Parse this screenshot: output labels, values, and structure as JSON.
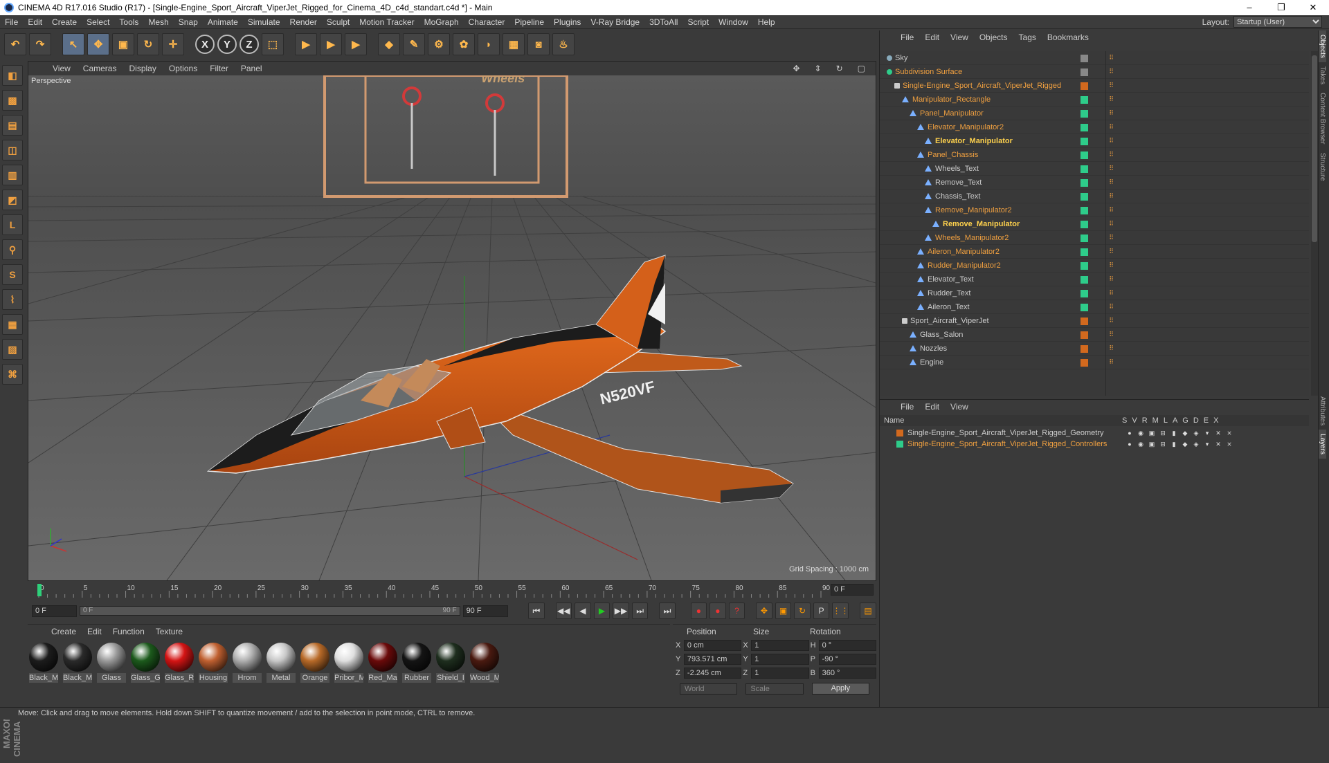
{
  "window": {
    "title": "CINEMA 4D R17.016 Studio (R17) - [Single-Engine_Sport_Aircraft_ViperJet_Rigged_for_Cinema_4D_c4d_standart.c4d *] - Main",
    "min": "–",
    "max": "❐",
    "close": "✕"
  },
  "menu": [
    "File",
    "Edit",
    "Create",
    "Select",
    "Tools",
    "Mesh",
    "Snap",
    "Animate",
    "Simulate",
    "Render",
    "Sculpt",
    "Motion Tracker",
    "MoGraph",
    "Character",
    "Pipeline",
    "Plugins",
    "V-Ray Bridge",
    "3DToAll",
    "Script",
    "Window",
    "Help"
  ],
  "layout": {
    "label": "Layout:",
    "value": "Startup (User)"
  },
  "toolbar": {
    "undo": "↶",
    "redo": "↷",
    "select": "↖",
    "move": "✥",
    "scale": "▣",
    "rotate": "↻",
    "move2": "✛",
    "x": "X",
    "y": "Y",
    "z": "Z",
    "coord": "⬚",
    "render1": "▶",
    "render2": "▶",
    "render3": "▶",
    "cube": "◆",
    "pen": "✎",
    "gear": "⚙",
    "flower": "✿",
    "deform": "◗",
    "grid": "▦",
    "camera": "◙",
    "light": "♨"
  },
  "lefttools": [
    "◧",
    "▩",
    "▤",
    "◫",
    "▥",
    "◩",
    "L",
    "⚲",
    "S",
    "⌇",
    "▦",
    "▨",
    "⌘"
  ],
  "maxon": "MAXON CINEMA 4D",
  "viewport": {
    "menu": [
      "View",
      "Cameras",
      "Display",
      "Options",
      "Filter",
      "Panel"
    ],
    "icons": [
      "✥",
      "⇕",
      "↻",
      "▢"
    ],
    "label": "Perspective",
    "grid_spacing": "Grid Spacing : 1000 cm",
    "tail_number": "N520VF",
    "ghost_text": "Wheels"
  },
  "timeline": {
    "ticks": [
      "0",
      "5",
      "10",
      "15",
      "20",
      "25",
      "30",
      "35",
      "40",
      "45",
      "50",
      "55",
      "60",
      "65",
      "70",
      "75",
      "80",
      "85",
      "90"
    ],
    "current_frame": "0 F"
  },
  "transport": {
    "start": "0 F",
    "slider_start": "0 F",
    "slider_end": "90 F",
    "end": "90 F",
    "btns": [
      "⏮",
      "◀◀",
      "◀",
      "▶",
      "▶▶",
      "⏭",
      "⏭"
    ],
    "rec": [
      "●",
      "●",
      "?"
    ],
    "keys": [
      "✥",
      "▣",
      "↻",
      "P",
      "⋮⋮",
      "▤"
    ]
  },
  "materials": {
    "menu": [
      "Create",
      "Edit",
      "Function",
      "Texture"
    ],
    "items": [
      {
        "label": "Black_M",
        "color": "#1c1c1c"
      },
      {
        "label": "Black_M",
        "color": "#2a2a2a"
      },
      {
        "label": "Glass",
        "color": "#9a9a9a"
      },
      {
        "label": "Glass_G",
        "color": "#1c5a1c"
      },
      {
        "label": "Glass_R",
        "color": "#d41414"
      },
      {
        "label": "Housing",
        "color": "#c06030"
      },
      {
        "label": "Hrom",
        "color": "#b0b0b0"
      },
      {
        "label": "Metal",
        "color": "#c8c8c8"
      },
      {
        "label": "Orange",
        "color": "#b86a28"
      },
      {
        "label": "Pribor_M",
        "color": "#e0e0e0"
      },
      {
        "label": "Red_Ma",
        "color": "#6a0a0a"
      },
      {
        "label": "Rubber",
        "color": "#141414"
      },
      {
        "label": "Shield_I",
        "color": "#1e2e1e"
      },
      {
        "label": "Wood_M",
        "color": "#4a1a10"
      }
    ]
  },
  "coords": {
    "head": {
      "position": "Position",
      "size": "Size",
      "rotation": "Rotation"
    },
    "rows": [
      {
        "ax": "X",
        "pos": "0 cm",
        "sax": "X",
        "size": "1",
        "rax": "H",
        "rot": "0 °"
      },
      {
        "ax": "Y",
        "pos": "793.571 cm",
        "sax": "Y",
        "size": "1",
        "rax": "P",
        "rot": "-90 °"
      },
      {
        "ax": "Z",
        "pos": "-2.245 cm",
        "sax": "Z",
        "size": "1",
        "rax": "B",
        "rot": "360 °"
      }
    ],
    "world": "World",
    "scale": "Scale",
    "apply": "Apply"
  },
  "status": "Move: Click and drag to move elements. Hold down SHIFT to quantize movement / add to the selection in point mode, CTRL to remove.",
  "objects": {
    "menu": [
      "File",
      "Edit",
      "View",
      "Objects",
      "Tags",
      "Bookmarks"
    ],
    "rows": [
      {
        "name": "Sky",
        "indent": 0,
        "kind": "sky",
        "swatch": "#888",
        "color": "plain"
      },
      {
        "name": "Subdivision Surface",
        "indent": 0,
        "kind": "gear",
        "swatch": "#888",
        "color": "orange"
      },
      {
        "name": "Single-Engine_Sport_Aircraft_ViperJet_Rigged",
        "indent": 1,
        "kind": "null",
        "swatch": "#d2691e",
        "color": "orange"
      },
      {
        "name": "Manipulator_Rectangle",
        "indent": 2,
        "kind": "tri",
        "swatch": "#2ecc8a",
        "color": "orange"
      },
      {
        "name": "Panel_Manipulator",
        "indent": 3,
        "kind": "tri",
        "swatch": "#2ecc8a",
        "color": "orange"
      },
      {
        "name": "Elevator_Manipulator2",
        "indent": 4,
        "kind": "tri",
        "swatch": "#2ecc8a",
        "color": "orange"
      },
      {
        "name": "Elevator_Manipulator",
        "indent": 5,
        "kind": "tri",
        "swatch": "#2ecc8a",
        "color": "yellow"
      },
      {
        "name": "Panel_Chassis",
        "indent": 4,
        "kind": "tri",
        "swatch": "#2ecc8a",
        "color": "orange"
      },
      {
        "name": "Wheels_Text",
        "indent": 5,
        "kind": "tri",
        "swatch": "#2ecc8a",
        "color": "plain"
      },
      {
        "name": "Remove_Text",
        "indent": 5,
        "kind": "tri",
        "swatch": "#2ecc8a",
        "color": "plain"
      },
      {
        "name": "Chassis_Text",
        "indent": 5,
        "kind": "tri",
        "swatch": "#2ecc8a",
        "color": "plain"
      },
      {
        "name": "Remove_Manipulator2",
        "indent": 5,
        "kind": "tri",
        "swatch": "#2ecc8a",
        "color": "orange"
      },
      {
        "name": "Remove_Manipulator",
        "indent": 6,
        "kind": "tri",
        "swatch": "#2ecc8a",
        "color": "yellow"
      },
      {
        "name": "Wheels_Manipulator2",
        "indent": 5,
        "kind": "tri",
        "swatch": "#2ecc8a",
        "color": "orange"
      },
      {
        "name": "Aileron_Manipulator2",
        "indent": 4,
        "kind": "tri",
        "swatch": "#2ecc8a",
        "color": "orange"
      },
      {
        "name": "Rudder_Manipulator2",
        "indent": 4,
        "kind": "tri",
        "swatch": "#2ecc8a",
        "color": "orange"
      },
      {
        "name": "Elevator_Text",
        "indent": 4,
        "kind": "tri",
        "swatch": "#2ecc8a",
        "color": "plain"
      },
      {
        "name": "Rudder_Text",
        "indent": 4,
        "kind": "tri",
        "swatch": "#2ecc8a",
        "color": "plain"
      },
      {
        "name": "Aileron_Text",
        "indent": 4,
        "kind": "tri",
        "swatch": "#2ecc8a",
        "color": "plain"
      },
      {
        "name": "Sport_Aircraft_ViperJet",
        "indent": 2,
        "kind": "null",
        "swatch": "#d2691e",
        "color": "plain"
      },
      {
        "name": "Glass_Salon",
        "indent": 3,
        "kind": "tri",
        "swatch": "#d2691e",
        "color": "plain"
      },
      {
        "name": "Nozzles",
        "indent": 3,
        "kind": "tri",
        "swatch": "#d2691e",
        "color": "plain"
      },
      {
        "name": "Engine",
        "indent": 3,
        "kind": "tri",
        "swatch": "#d2691e",
        "color": "plain"
      }
    ]
  },
  "layers": {
    "menu": [
      "File",
      "Edit",
      "View"
    ],
    "head_name": "Name",
    "cols": [
      "S",
      "V",
      "R",
      "M",
      "L",
      "A",
      "G",
      "D",
      "E",
      "X"
    ],
    "rows": [
      {
        "name": "Single-Engine_Sport_Aircraft_ViperJet_Rigged_Geometry",
        "color": "#d2691e",
        "text": "#cccccc"
      },
      {
        "name": "Single-Engine_Sport_Aircraft_ViperJet_Rigged_Controllers",
        "color": "#2ecc8a",
        "text": "#f0a040"
      }
    ]
  },
  "sidetabs": [
    "Objects",
    "Takes",
    "Content Browser",
    "Structure",
    "Attributes",
    "Layers"
  ]
}
